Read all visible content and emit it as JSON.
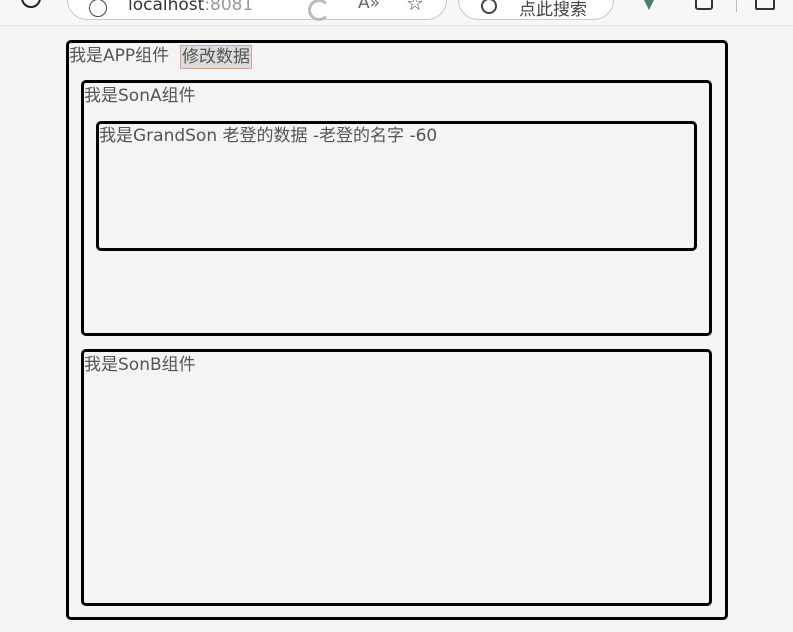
{
  "browser": {
    "url_host": "localhost",
    "url_port": ":8081",
    "read_aloud_label": "A»",
    "search_placeholder": "点此搜索"
  },
  "app": {
    "label": "我是APP组件",
    "modify_button_label": "修改数据"
  },
  "sonA": {
    "label": "我是SonA组件"
  },
  "grandSon": {
    "label": "我是GrandSon 老登的数据 -老登的名字 -60"
  },
  "sonB": {
    "label": "我是SonB组件"
  },
  "colors": {
    "page_background": "#f4f4f4",
    "border": "#000000",
    "text": "#555555",
    "button_background": "#dcdcdc",
    "button_border": "#d8a090"
  }
}
